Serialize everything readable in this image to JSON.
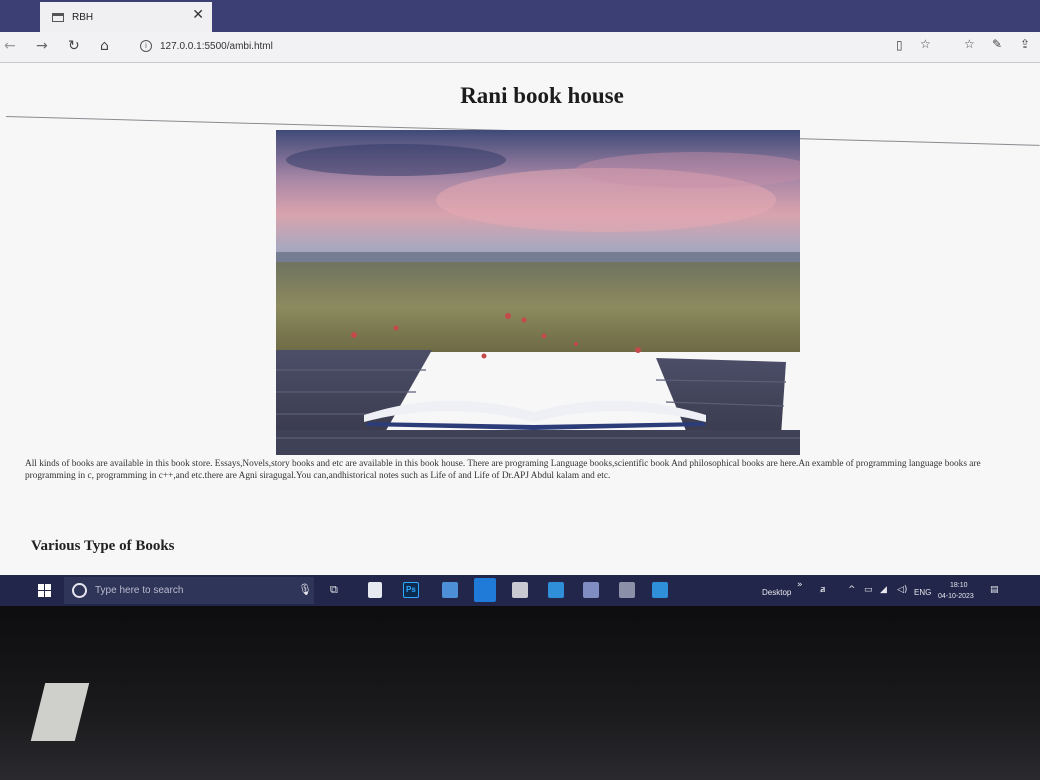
{
  "browser": {
    "tab_title": "RBH",
    "url": "127.0.0.1:5500/ambi.html"
  },
  "page": {
    "title": "Rani book house",
    "description": "All kinds of books are available in this book store. Essays,Novels,story books and etc are available in this book house. There are programing Language books,scientific book And philosophical books are here.An examble of programming language books are programming in c, programming in c++,and etc.there are Agni siragugal.You can,andhistorical notes such as Life of and Life of Dr.APJ Abdul kalam and etc.",
    "section_heading": "Various Type of Books"
  },
  "taskbar": {
    "search_placeholder": "Type here to search",
    "desktop_label": "Desktop",
    "language": "ENG",
    "time": "18:10",
    "date": "04-10-2023",
    "photoshop_label": "Ps"
  },
  "icons": {
    "back": "back-arrow-icon",
    "forward": "forward-arrow-icon",
    "refresh": "refresh-icon",
    "home": "home-icon",
    "favorite": "star-icon",
    "start": "windows-start-icon"
  },
  "colors": {
    "taskbar_bg": "#21264a",
    "tabstrip_bg": "#3b3f73",
    "page_bg": "#f7f7f8"
  }
}
